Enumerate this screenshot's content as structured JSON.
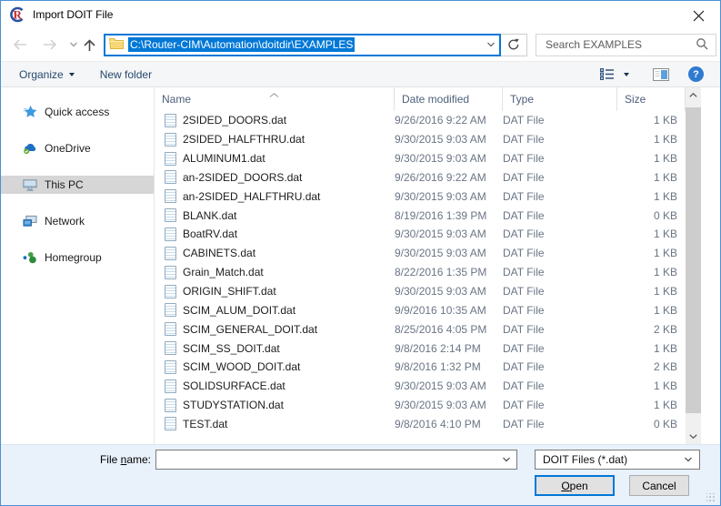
{
  "window": {
    "title": "Import DOIT File"
  },
  "nav": {
    "address": "C:\\Router-CIM\\Automation\\doitdir\\EXAMPLES",
    "search_placeholder": "Search EXAMPLES"
  },
  "toolbar": {
    "organize_label": "Organize",
    "new_folder_label": "New folder"
  },
  "sidebar": {
    "items": [
      {
        "label": "Quick access",
        "icon": "star",
        "selected": false
      },
      {
        "label": "OneDrive",
        "icon": "onedrive",
        "selected": false
      },
      {
        "label": "This PC",
        "icon": "this-pc",
        "selected": true
      },
      {
        "label": "Network",
        "icon": "network",
        "selected": false
      },
      {
        "label": "Homegroup",
        "icon": "homegroup",
        "selected": false
      }
    ]
  },
  "file_list": {
    "columns": [
      "Name",
      "Date modified",
      "Type",
      "Size"
    ],
    "rows": [
      {
        "name": "2SIDED_DOORS.dat",
        "date": "9/26/2016 9:22 AM",
        "type": "DAT File",
        "size": "1 KB"
      },
      {
        "name": "2SIDED_HALFTHRU.dat",
        "date": "9/30/2015 9:03 AM",
        "type": "DAT File",
        "size": "1 KB"
      },
      {
        "name": "ALUMINUM1.dat",
        "date": "9/30/2015 9:03 AM",
        "type": "DAT File",
        "size": "1 KB"
      },
      {
        "name": "an-2SIDED_DOORS.dat",
        "date": "9/26/2016 9:22 AM",
        "type": "DAT File",
        "size": "1 KB"
      },
      {
        "name": "an-2SIDED_HALFTHRU.dat",
        "date": "9/30/2015 9:03 AM",
        "type": "DAT File",
        "size": "1 KB"
      },
      {
        "name": "BLANK.dat",
        "date": "8/19/2016 1:39 PM",
        "type": "DAT File",
        "size": "0 KB"
      },
      {
        "name": "BoatRV.dat",
        "date": "9/30/2015 9:03 AM",
        "type": "DAT File",
        "size": "1 KB"
      },
      {
        "name": "CABINETS.dat",
        "date": "9/30/2015 9:03 AM",
        "type": "DAT File",
        "size": "1 KB"
      },
      {
        "name": "Grain_Match.dat",
        "date": "8/22/2016 1:35 PM",
        "type": "DAT File",
        "size": "1 KB"
      },
      {
        "name": "ORIGIN_SHIFT.dat",
        "date": "9/30/2015 9:03 AM",
        "type": "DAT File",
        "size": "1 KB"
      },
      {
        "name": "SCIM_ALUM_DOIT.dat",
        "date": "9/9/2016 10:35 AM",
        "type": "DAT File",
        "size": "1 KB"
      },
      {
        "name": "SCIM_GENERAL_DOIT.dat",
        "date": "8/25/2016 4:05 PM",
        "type": "DAT File",
        "size": "2 KB"
      },
      {
        "name": "SCIM_SS_DOIT.dat",
        "date": "9/8/2016 2:14 PM",
        "type": "DAT File",
        "size": "1 KB"
      },
      {
        "name": "SCIM_WOOD_DOIT.dat",
        "date": "9/8/2016 1:32 PM",
        "type": "DAT File",
        "size": "2 KB"
      },
      {
        "name": "SOLIDSURFACE.dat",
        "date": "9/30/2015 9:03 AM",
        "type": "DAT File",
        "size": "1 KB"
      },
      {
        "name": "STUDYSTATION.dat",
        "date": "9/30/2015 9:03 AM",
        "type": "DAT File",
        "size": "1 KB"
      },
      {
        "name": "TEST.dat",
        "date": "9/8/2016 4:10 PM",
        "type": "DAT File",
        "size": "0 KB"
      }
    ]
  },
  "footer": {
    "file_name_label": {
      "pre": "File ",
      "accel": "n",
      "post": "ame:"
    },
    "file_name_value": "",
    "filter_value": "DOIT Files (*.dat)",
    "open_label": {
      "pre": "",
      "accel": "O",
      "post": "pen"
    },
    "cancel_label": "Cancel"
  },
  "colors": {
    "accent": "#0078d7",
    "selection_bg": "#0078d7",
    "sidebar_selected_bg": "#d6d6d6",
    "window_border": "#4a91d6",
    "footer_bg": "#e9f1fb",
    "button_bg": "#e1e1e1"
  }
}
